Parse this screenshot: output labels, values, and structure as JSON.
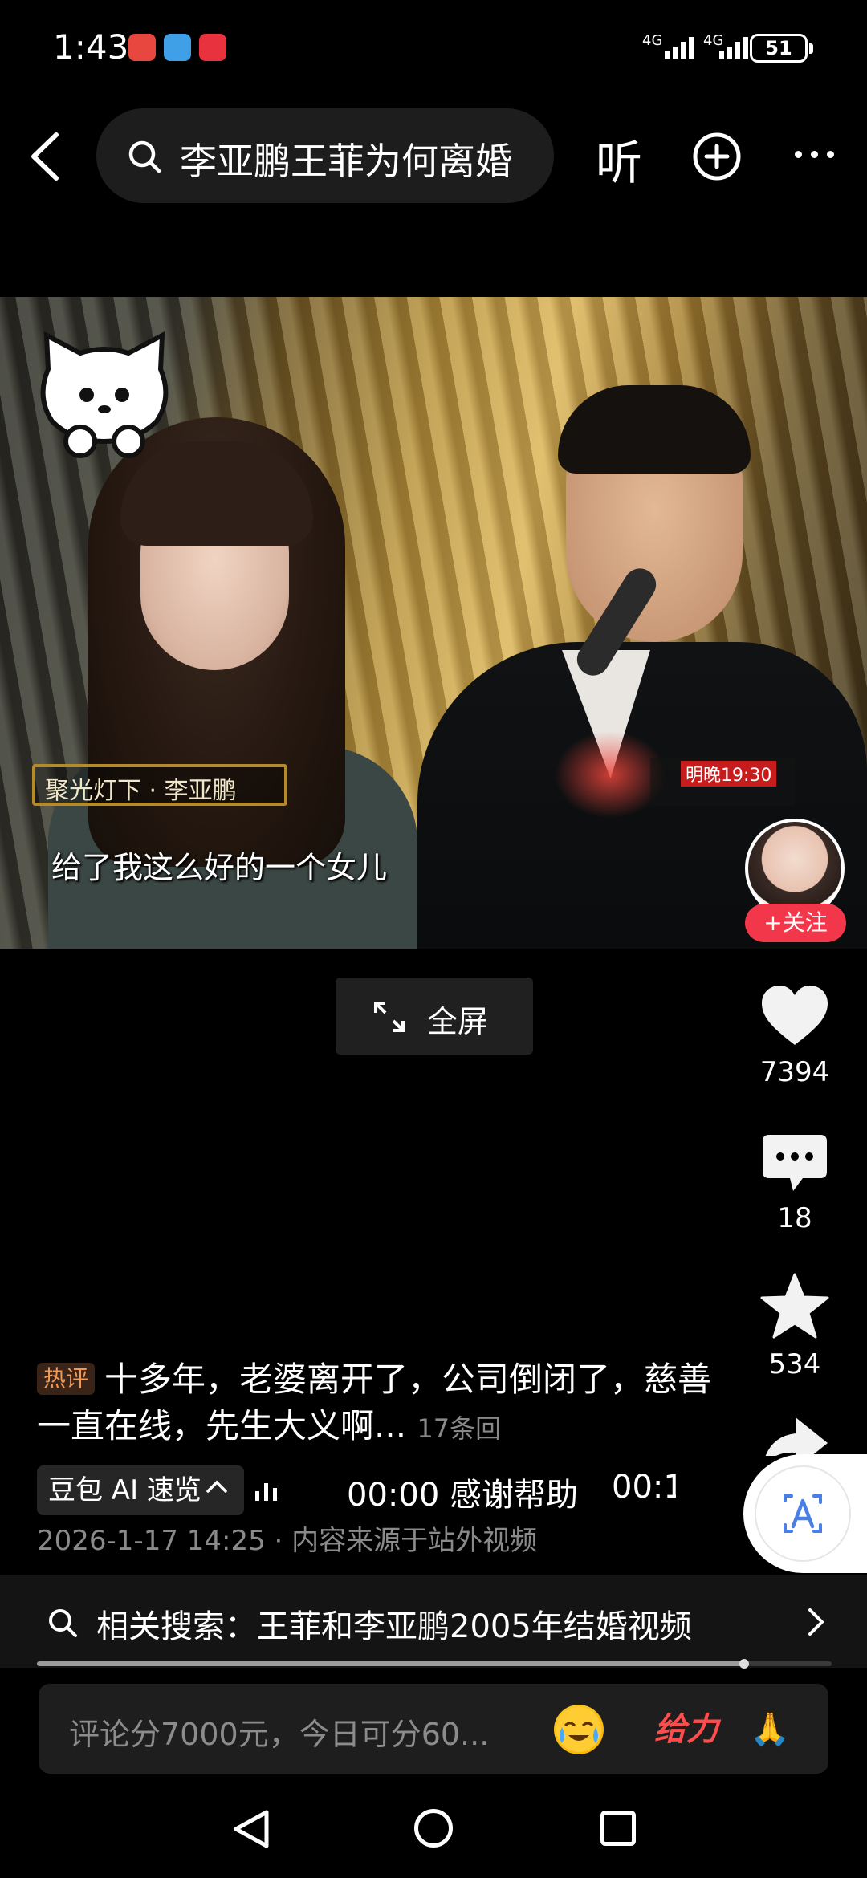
{
  "status_bar": {
    "time": "1:43",
    "net1": "4G",
    "net2": "4G",
    "battery": "51"
  },
  "top_nav": {
    "search_query": "李亚鹏王菲为何离婚",
    "listen_label": "听"
  },
  "video": {
    "tv_tag": "聚光灯下 · 李亚鹏",
    "tv_time": "明晚19:30",
    "subtitle": "给了我这么好的一个女儿",
    "follow_label": "+关注"
  },
  "fullscreen_label": "全屏",
  "actions": {
    "likes": "7394",
    "comments": "18",
    "favorites": "534"
  },
  "hot_comment": {
    "badge": "热评",
    "text": "十多年，老婆离开了，公司倒闭了，慈善一直在线，先生大义啊...",
    "reply_count": "17条回"
  },
  "ai_preview": {
    "pill_label": "豆包 AI 速览",
    "line": "00:00 感谢帮助",
    "line2": "00:1"
  },
  "meta": "2026-1-17 14:25 · 内容来源于站外视频",
  "related_search": "相关搜索：王菲和李亚鹏2005年结婚视频",
  "progress": 0.89,
  "comment_input": {
    "placeholder": "评论分7000元，今日可分60...",
    "emoji_2": "给力",
    "emoji_3": "🙏"
  },
  "colors": {
    "background": "#000000",
    "follow_red": "#f2374b",
    "hot_badge_text": "#f09a57",
    "ai_blue": "#4a7fe6"
  }
}
